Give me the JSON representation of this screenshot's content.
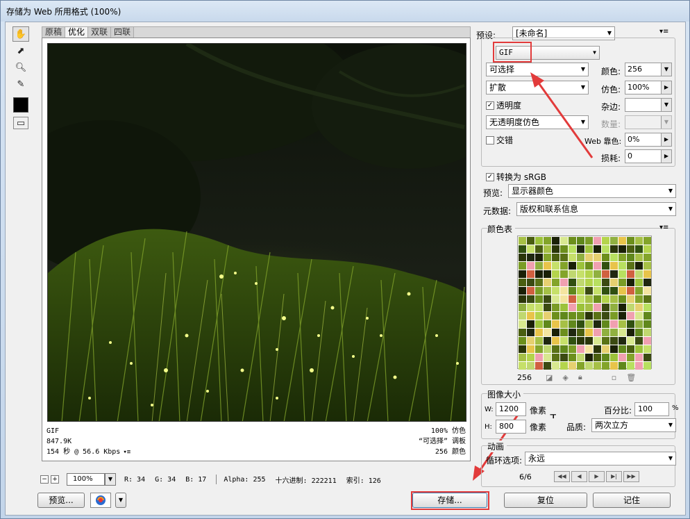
{
  "window": {
    "title": "存储为 Web 所用格式 (100%)"
  },
  "tools": [
    {
      "name": "hand-tool-icon"
    },
    {
      "name": "slice-select-tool-icon"
    },
    {
      "name": "zoom-tool-icon"
    },
    {
      "name": "eyedropper-tool-icon"
    }
  ],
  "tabs": [
    "原稿",
    "优化",
    "双联",
    "四联"
  ],
  "active_tab": 1,
  "preview": {
    "left": [
      "GIF",
      "847.9K",
      "154 秒 @ 56.6 Kbps"
    ],
    "right": [
      "100% 仿色",
      "“可选择” 调板",
      "256 颜色"
    ]
  },
  "status": {
    "zoom": "100%",
    "r": "R: 34",
    "g": "G: 34",
    "b": "B: 17",
    "alpha": "Alpha: 255",
    "hex": "十六进制: 222211",
    "index": "索引: 126"
  },
  "buttons": {
    "preview": "预览...",
    "save": "存储...",
    "reset": "复位",
    "remember": "记住"
  },
  "settings": {
    "preset_label": "预设:",
    "preset_value": "[未命名]",
    "format": "GIF",
    "reduction": "可选择",
    "dither_algo": "扩散",
    "transparency_label": "透明度",
    "transparency_dither": "无透明度仿色",
    "interlaced_label": "交错",
    "colors_label": "颜色:",
    "colors_value": "256",
    "dither_label": "仿色:",
    "dither_value": "100%",
    "matte_label": "杂边:",
    "amount_label": "数量:",
    "web_snap_label": "Web 靠色:",
    "web_snap_value": "0%",
    "lossy_label": "损耗:",
    "lossy_value": "0",
    "convert_srgb": "转换为 sRGB",
    "preview_label": "预览:",
    "preview_value": "显示器颜色",
    "metadata_label": "元数据:",
    "metadata_value": "版权和联系信息"
  },
  "color_table": {
    "title": "颜色表",
    "count": "256"
  },
  "image_size": {
    "title": "图像大小",
    "w_label": "W:",
    "w_value": "1200",
    "h_label": "H:",
    "h_value": "800",
    "unit": "像素",
    "percent_label": "百分比:",
    "percent_value": "100",
    "percent_unit": "%",
    "quality_label": "品质:",
    "quality_value": "两次立方"
  },
  "animation": {
    "title": "动画",
    "loop_label": "循环选项:",
    "loop_value": "永远",
    "frame": "6/6"
  },
  "colors": {
    "highlight": "#e23b3b",
    "accent": "#3c7fb1"
  }
}
